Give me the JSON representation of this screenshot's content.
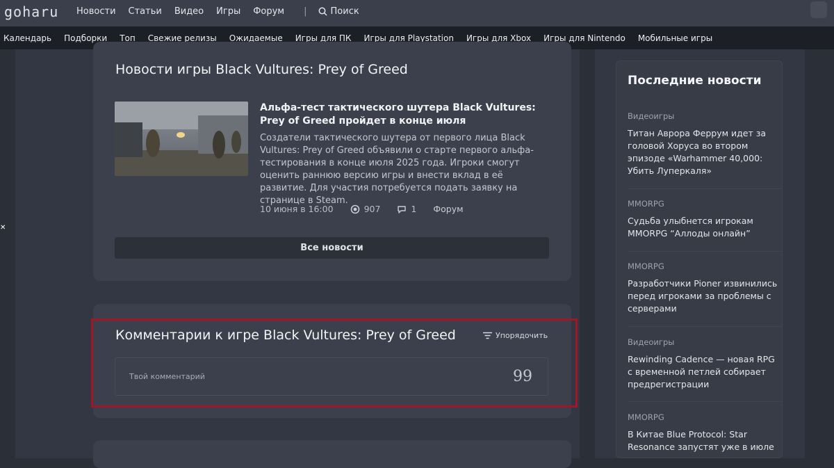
{
  "header": {
    "logo_text": "goharu",
    "nav": [
      "Новости",
      "Статьи",
      "Видео",
      "Игры",
      "Форум"
    ],
    "separator": "|",
    "search_label": "Поиск"
  },
  "categories": [
    "Календарь",
    "Подборки",
    "Топ",
    "Свежие релизы",
    "Ожидаемые",
    "Игры для ПК",
    "Игры для Playstation",
    "Игры для Xbox",
    "Игры для Nintendo",
    "Мобильные игры"
  ],
  "news": {
    "title": "Новости игры Black Vultures: Prey of Greed",
    "article": {
      "title": "Альфа-тест тактического шутера Black Vultures: Prey of Greed пройдет в конце июля",
      "description": "Создатели тактического шутера от первого лица Black Vultures: Prey of Greed объявили о старте первого альфа-тестирования в конце июля 2025 года. Игроки смогут оценить раннюю версию игры и внести вклад в её развитие. Для участия потребуется подать заявку на странице в Steam.",
      "date": "10 июня в 16:00",
      "views": "907",
      "comments": "1",
      "forum": "Форум"
    },
    "all_news_label": "Все новости"
  },
  "comments": {
    "title": "Комментарии к игре Black Vultures: Prey of Greed",
    "sort_label": "Упорядочить",
    "placeholder": "Твой комментарий",
    "quote_glyph": "99"
  },
  "sidebar": {
    "title": "Последние новости",
    "items": [
      {
        "category": "Видеоигры",
        "text": "Титан Аврора Феррум идет за головой Хоруса во втором эпизоде «Warhammer 40,000: Убить Луперкаля»"
      },
      {
        "category": "MMORPG",
        "text": "Судьба улыбнется игрокам MMORPG “Аллоды онлайн”"
      },
      {
        "category": "MMORPG",
        "text": "Разработчики Pioner извинились перед игроками за проблемы с серверами"
      },
      {
        "category": "Видеоигры",
        "text": "Rewinding Cadence — новая RPG с временной петлей собирает предрегистрации"
      },
      {
        "category": "MMORPG",
        "text": "В Китае Blue Protocol: Star Resonance запустят уже в июле"
      }
    ]
  },
  "colors": {
    "highlight": "#a01828",
    "background": "#2b2f38",
    "card": "#3b404c"
  }
}
